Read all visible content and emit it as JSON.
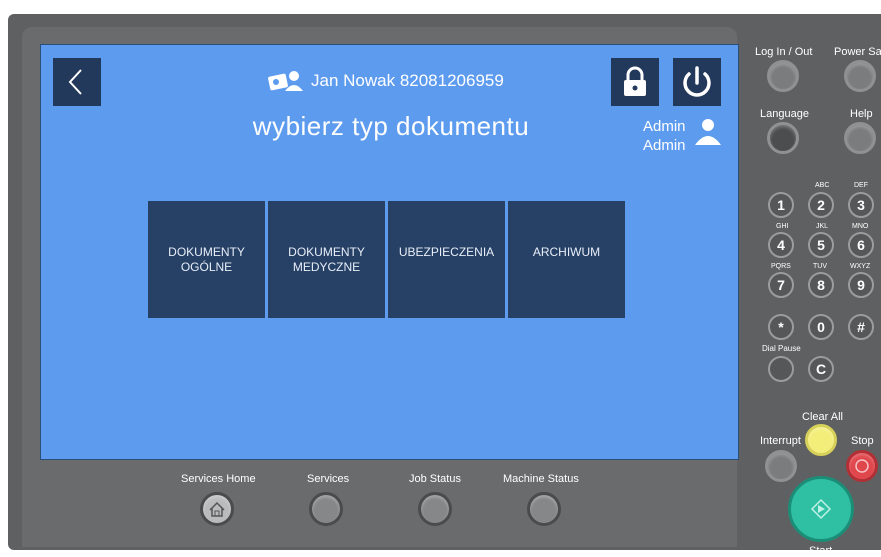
{
  "screen": {
    "back_icon": "chevron-left-icon",
    "user_icon": "id-card-user-icon",
    "user_name": "Jan Nowak 82081206959",
    "heading": "wybierz typ dokumentu",
    "lock_icon": "padlock-icon",
    "power_icon": "power-icon",
    "admin_line1": "Admin",
    "admin_line2": "Admin",
    "admin_icon": "person-icon",
    "tiles": [
      {
        "line1": "DOKUMENTY",
        "line2": "OGÓLNE"
      },
      {
        "line1": "DOKUMENTY",
        "line2": "MEDYCZNE"
      },
      {
        "line1": "UBEZPIECZENIA",
        "line2": ""
      },
      {
        "line1": "ARCHIWUM",
        "line2": ""
      }
    ],
    "colors": {
      "screen_bg": "#5d9bef",
      "tile_bg": "#264066",
      "button_bg": "#23395b"
    }
  },
  "bottom_buttons": {
    "services_home": "Services Home",
    "services": "Services",
    "job_status": "Job Status",
    "machine_status": "Machine Status",
    "home_icon": "home-icon"
  },
  "side_panel": {
    "log_in_out": "Log In / Out",
    "power_saver": "Power Saver",
    "language": "Language",
    "help": "Help",
    "keys": [
      {
        "key": "1",
        "letters": ""
      },
      {
        "key": "2",
        "letters": "ABC"
      },
      {
        "key": "3",
        "letters": "DEF"
      },
      {
        "key": "4",
        "letters": "GHI"
      },
      {
        "key": "5",
        "letters": "JKL"
      },
      {
        "key": "6",
        "letters": "MNO"
      },
      {
        "key": "7",
        "letters": "PQRS"
      },
      {
        "key": "8",
        "letters": "TUV"
      },
      {
        "key": "9",
        "letters": "WXYZ"
      },
      {
        "key": "*",
        "letters": ""
      },
      {
        "key": "0",
        "letters": ""
      },
      {
        "key": "#",
        "letters": ""
      }
    ],
    "dial_pause": "Dial Pause",
    "clear_key": "C",
    "clear_all": "Clear All",
    "interrupt": "Interrupt",
    "stop": "Stop",
    "start": "Start"
  }
}
